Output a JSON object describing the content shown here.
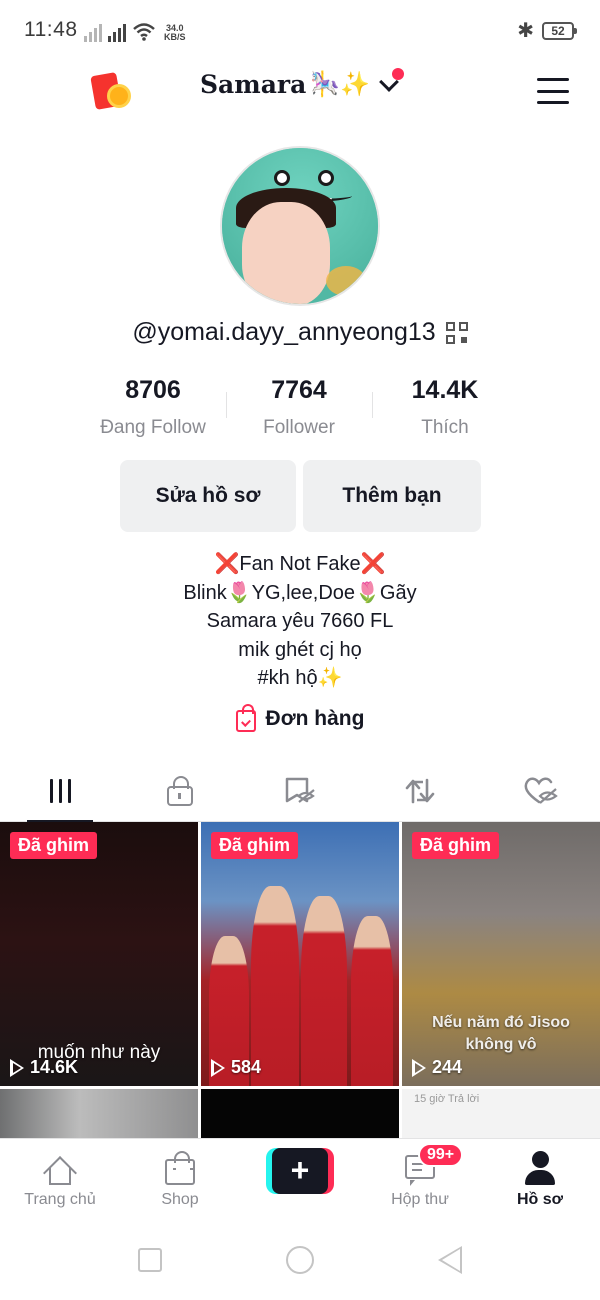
{
  "status_bar": {
    "time": "11:48",
    "speed": "34.0",
    "speed_unit": "KB/S",
    "battery": "52",
    "icons": [
      "signal-x-icon",
      "signal-icon",
      "wifi-icon",
      "bluetooth-icon",
      "battery-icon"
    ]
  },
  "header": {
    "title": "Samara",
    "title_deco": "🎠✨",
    "left_icon": "red-envelope-icon",
    "right_icon": "menu-icon"
  },
  "profile": {
    "username": "@yomai.dayy_annyeong13",
    "stats": [
      {
        "value": "8706",
        "label": "Đang Follow"
      },
      {
        "value": "7764",
        "label": "Follower"
      },
      {
        "value": "14.4K",
        "label": "Thích"
      }
    ],
    "edit_button": "Sửa hồ sơ",
    "add_friend_button": "Thêm bạn",
    "bio": [
      "❌Fan Not Fake❌",
      "Blink🌷YG,lee,Doe🌷Gãy",
      "Samara yêu 7660 FL",
      "mik ghét cj họ",
      "#kh hộ✨"
    ],
    "orders_label": "Đơn hàng"
  },
  "tabs": [
    {
      "name": "videos-tab",
      "icon": "grid-icon",
      "active": true
    },
    {
      "name": "private-tab",
      "icon": "lock-icon",
      "active": false
    },
    {
      "name": "saved-tab",
      "icon": "bookmark-hidden-icon",
      "active": false
    },
    {
      "name": "repost-tab",
      "icon": "repost-icon",
      "active": false
    },
    {
      "name": "liked-tab",
      "icon": "heart-hidden-icon",
      "active": false
    }
  ],
  "videos": [
    {
      "pinned": "Đã ghim",
      "caption": "muốn như này",
      "views": "14.6K"
    },
    {
      "pinned": "Đã ghim",
      "caption": "",
      "views": "584"
    },
    {
      "pinned": "Đã ghim",
      "caption": "Nếu năm đó Jisoo không vô",
      "views": "244"
    },
    {
      "snippet": ""
    },
    {
      "snippet": ""
    },
    {
      "snippet": "15 giờ  Trả lời"
    }
  ],
  "bottom_nav": [
    {
      "label": "Trang chủ",
      "icon": "home-icon",
      "active": false
    },
    {
      "label": "Shop",
      "icon": "shop-bag-icon",
      "active": false
    },
    {
      "label": "",
      "icon": "plus-icon",
      "active": false
    },
    {
      "label": "Hộp thư",
      "icon": "inbox-icon",
      "active": false,
      "badge": "99+"
    },
    {
      "label": "Hồ sơ",
      "icon": "profile-icon",
      "active": true
    }
  ],
  "colors": {
    "accent": "#fe2c55",
    "text": "#161823",
    "muted": "#8a8b91",
    "button_bg": "#eff0f1",
    "cyan": "#25f4ee"
  }
}
